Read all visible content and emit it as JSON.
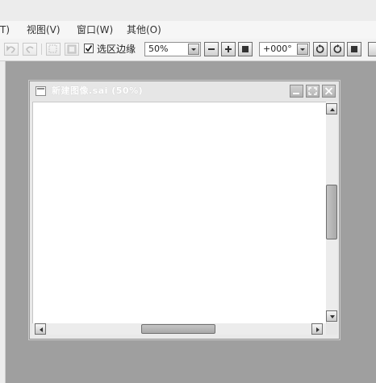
{
  "menu": {
    "items": [
      {
        "label": "T)"
      },
      {
        "label": "视图(V)"
      },
      {
        "label": "窗口(W)"
      },
      {
        "label": "其他(O)"
      }
    ]
  },
  "toolbar": {
    "selection_edge": {
      "label": "选区边缘",
      "checked": true
    },
    "zoom": {
      "value": "50%"
    },
    "rotation": {
      "value": "+000°"
    }
  },
  "document": {
    "title": "新建图像.sai (50%)"
  },
  "colors": {
    "workspace_bg": "#9f9f9f",
    "canvas_bg": "#ffffff",
    "chrome_bg": "#ececec"
  },
  "icons": [
    "undo-icon",
    "redo-icon",
    "deselect-icon",
    "invert-selection-icon",
    "checkmark-icon",
    "chevron-down-icon",
    "minus-icon",
    "plus-icon",
    "square-icon",
    "rotate-left-icon",
    "rotate-right-icon",
    "reset-icon",
    "document-icon",
    "minimize-icon",
    "maximize-icon",
    "close-icon",
    "arrow-up-icon",
    "arrow-down-icon",
    "arrow-left-icon",
    "arrow-right-icon"
  ]
}
